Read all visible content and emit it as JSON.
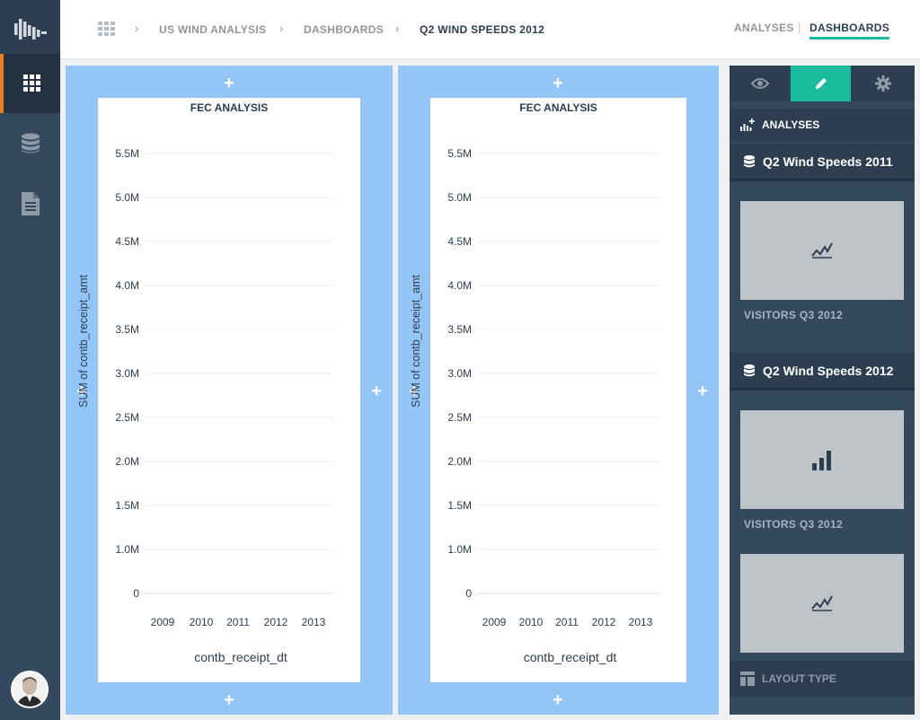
{
  "breadcrumbs": [
    "US WIND ANALYSIS",
    "DASHBOARDS",
    "Q2 WIND SPEEDS 2012"
  ],
  "topnav": {
    "analyses": "ANALYSES",
    "dashboards": "DASHBOARDS"
  },
  "panels": [
    {
      "title": "FEC ANALYSIS",
      "ylabel": "SUM of contb_receipt_amt",
      "xlabel": "contb_receipt_dt"
    },
    {
      "title": "FEC ANALYSIS",
      "ylabel": "SUM of contb_receipt_amt",
      "xlabel": "contb_receipt_dt"
    }
  ],
  "chart_data": [
    {
      "type": "line",
      "title": "FEC ANALYSIS",
      "xlabel": "contb_receipt_dt",
      "ylabel": "SUM of contb_receipt_amt",
      "x_ticks": [
        "2009",
        "2010",
        "2011",
        "2012",
        "2013"
      ],
      "y_ticks": [
        "0",
        "1.0M",
        "1.5M",
        "2.0M",
        "2.5M",
        "3.0M",
        "3.5M",
        "4.0M",
        "4.5M",
        "5.0M",
        "5.5M"
      ],
      "grid": true,
      "series": []
    },
    {
      "type": "line",
      "title": "FEC ANALYSIS",
      "xlabel": "contb_receipt_dt",
      "ylabel": "SUM of contb_receipt_amt",
      "x_ticks": [
        "2009",
        "2010",
        "2011",
        "2012",
        "2013"
      ],
      "y_ticks": [
        "0",
        "1.0M",
        "1.5M",
        "2.0M",
        "2.5M",
        "3.0M",
        "3.5M",
        "4.0M",
        "4.5M",
        "5.0M",
        "5.5M"
      ],
      "grid": true,
      "series": []
    }
  ],
  "sidebar": {
    "tabs": [
      {
        "icon": "eye-icon"
      },
      {
        "icon": "pencil-icon"
      },
      {
        "icon": "gear-icon"
      }
    ],
    "analyses_label": "ANALYSES",
    "groups": [
      {
        "title": "Q2 Wind Speeds 2011",
        "items": [
          {
            "label": "VISITORS Q3 2012",
            "icon": "line-chart-icon"
          }
        ]
      },
      {
        "title": "Q2 Wind Speeds 2012",
        "items": [
          {
            "label": "VISITORS Q3 2012",
            "icon": "bar-chart-icon"
          },
          {
            "label": "",
            "icon": "line-chart-icon"
          }
        ]
      }
    ],
    "layout_label": "LAYOUT TYPE"
  },
  "colors": {
    "accent": "#1abc9c",
    "nav": "#34495e",
    "panel": "#94c5f7",
    "nav_active_marker": "#e67e22"
  }
}
